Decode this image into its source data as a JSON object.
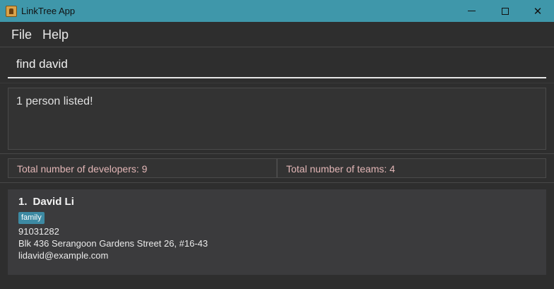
{
  "window": {
    "title": "LinkTree App",
    "controls": {
      "minimize": "minimize",
      "maximize": "maximize",
      "close": "✕"
    }
  },
  "menu": {
    "items": [
      "File",
      "Help"
    ]
  },
  "command": {
    "value": "find david"
  },
  "result": {
    "message": "1 person listed!"
  },
  "stats": {
    "developers": "Total number of developers: 9",
    "teams": "Total number of teams: 4"
  },
  "persons": [
    {
      "index": "1.",
      "name": "David Li",
      "tags": [
        "family"
      ],
      "phone": "91031282",
      "address": "Blk 436 Serangoon Gardens Street 26, #16-43",
      "email": "lidavid@example.com"
    }
  ],
  "colors": {
    "titlebar": "#3f97aa",
    "stat_text": "#e2b6b6",
    "tag_bg": "#3d8aa3",
    "background": "#2e2e2e"
  },
  "icons": {
    "app": "linktree-app-icon",
    "minimize": "minimize-icon",
    "maximize": "maximize-icon",
    "close": "close-icon"
  }
}
